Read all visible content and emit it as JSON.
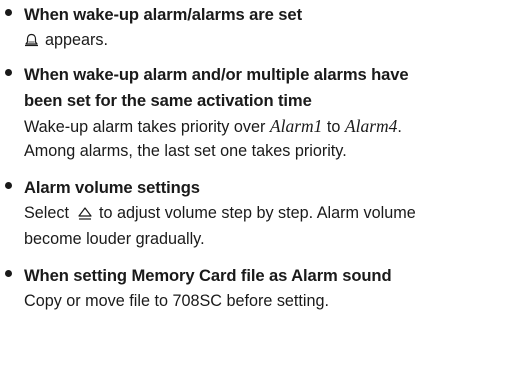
{
  "items": [
    {
      "heading": "When wake-up alarm/alarms are set",
      "body_after_icon": "appears.",
      "icon": "alarm-bell-icon"
    },
    {
      "heading_line1": "When wake-up alarm and/or multiple alarms have",
      "heading_line2": "been set for the same activation time",
      "body1_pre": "Wake-up alarm takes priority over ",
      "alarm_first": "Alarm1",
      "body1_mid": " to ",
      "alarm_last": "Alarm4",
      "body1_end": ".",
      "body2": "Among alarms, the last set one takes priority."
    },
    {
      "heading": "Alarm volume settings",
      "body1_pre": "Select",
      "body1_post": "to adjust volume step by step. Alarm volume",
      "body2": "become louder gradually.",
      "icon": "volume-up-icon"
    },
    {
      "heading": "When setting Memory Card file as Alarm sound",
      "body": "Copy or move file to 708SC before setting."
    }
  ]
}
